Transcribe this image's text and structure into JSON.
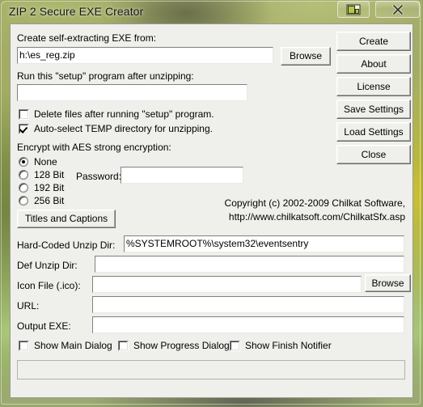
{
  "window": {
    "title": "ZIP 2 Secure EXE Creator",
    "controls": [
      {
        "name": "restore-button",
        "icon": "restore-icon"
      },
      {
        "name": "close-button",
        "icon": "close-icon"
      }
    ]
  },
  "form": {
    "source_label": "Create self-extracting EXE from:",
    "source_value": "h:\\es_reg.zip",
    "source_browse_label": "Browse",
    "setup_label": "Run this \"setup\" program after unzipping:",
    "setup_value": "",
    "checkboxes_top": [
      {
        "label": "Delete files after running \"setup\" program.",
        "checked": false
      },
      {
        "label": "Auto-select TEMP directory for unzipping.",
        "checked": true
      }
    ],
    "encryption_label": "Encrypt with AES strong encryption:",
    "encryption_options": [
      {
        "label": "None",
        "selected": true
      },
      {
        "label": "128 Bit",
        "selected": false
      },
      {
        "label": "192 Bit",
        "selected": false
      },
      {
        "label": "256 Bit",
        "selected": false
      }
    ],
    "password_label": "Password:",
    "password_value": "",
    "titles_button_label": "Titles and Captions",
    "copyright_line1": "Copyright (c) 2002-2009 Chilkat Software,",
    "copyright_line2": "http://www.chilkatsoft.com/ChilkatSfx.asp",
    "fields": [
      {
        "label": "Hard-Coded Unzip Dir:",
        "value": "%SYSTEMROOT%\\system32\\eventsentry"
      },
      {
        "label": "Def Unzip Dir:",
        "value": ""
      },
      {
        "label": "Icon File (.ico):",
        "value": ""
      },
      {
        "label": "URL:",
        "value": ""
      },
      {
        "label": "Output EXE:",
        "value": ""
      }
    ],
    "icon_browse_label": "Browse",
    "checkboxes_bottom": [
      {
        "label": "Show Main Dialog",
        "checked": false
      },
      {
        "label": "Show Progress Dialog",
        "checked": false
      },
      {
        "label": "Show Finish Notifier",
        "checked": false
      }
    ]
  },
  "actions": [
    {
      "label": "Create"
    },
    {
      "label": "About"
    },
    {
      "label": "License"
    },
    {
      "label": "Save Settings"
    },
    {
      "label": "Load Settings"
    },
    {
      "label": "Close"
    }
  ],
  "colors": {
    "client_bg": "#efefeb",
    "field_bg": "#ffffff",
    "text": "#000000",
    "frame_glass": "#8da049"
  }
}
